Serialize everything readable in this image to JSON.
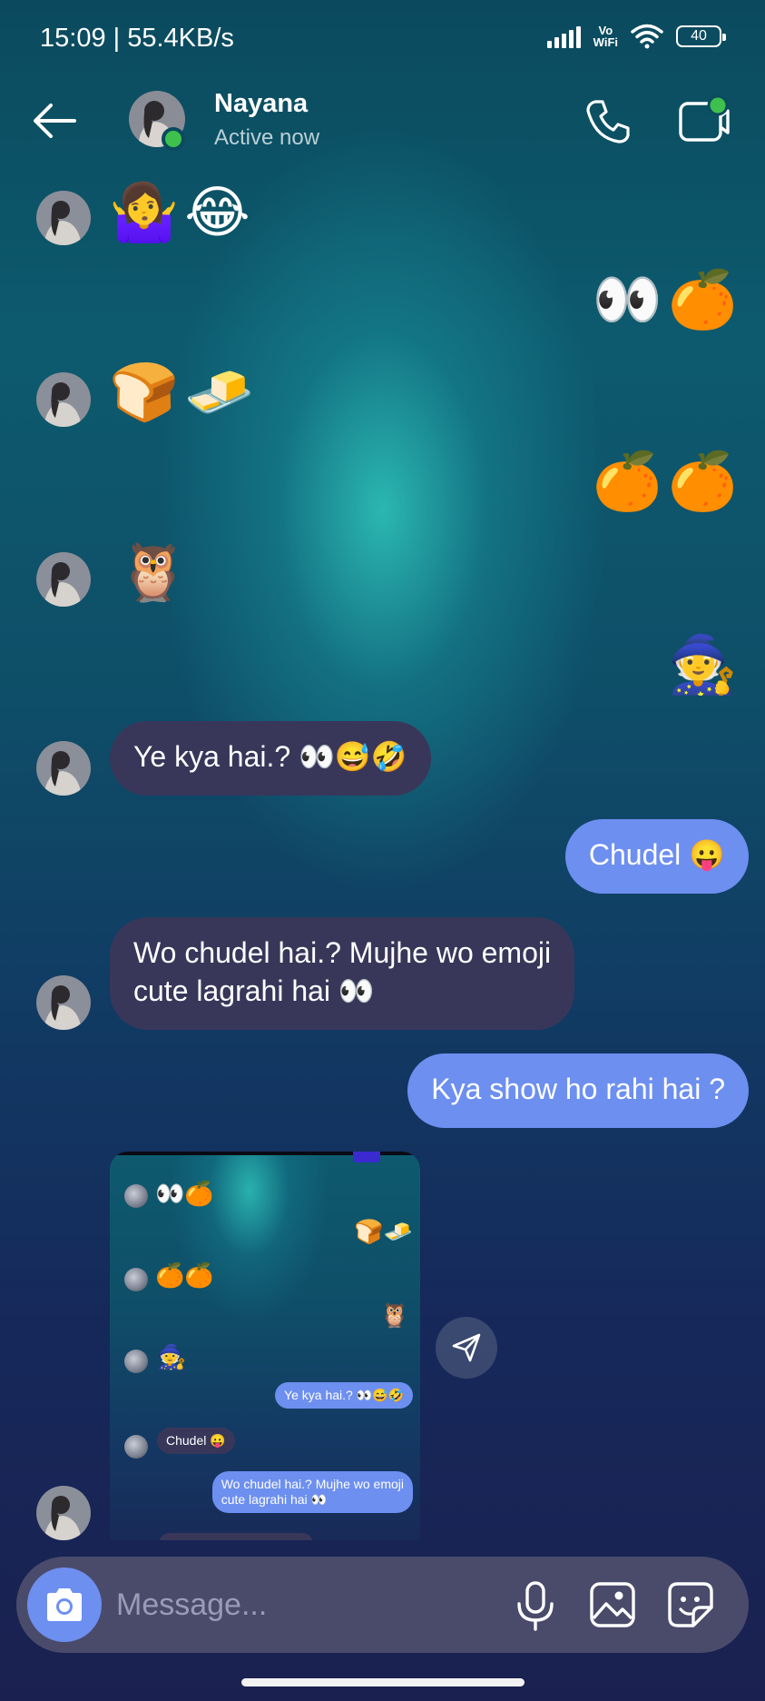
{
  "status_bar": {
    "time": "15:09 | 55.4KB/s",
    "network": "Vo WiFi",
    "network_top": "Vo",
    "network_bottom": "WiFi",
    "battery": "40"
  },
  "header": {
    "contact_name": "Nayana",
    "contact_status": "Active now",
    "online_color": "#3ec14c"
  },
  "messages": [
    {
      "side": "in",
      "kind": "emoji",
      "emojis": [
        "🤷‍♀️",
        "😂"
      ]
    },
    {
      "side": "out",
      "kind": "emoji",
      "emojis": [
        "👀",
        "🍊"
      ]
    },
    {
      "side": "in",
      "kind": "emoji",
      "emojis": [
        "🍞",
        "🧈"
      ]
    },
    {
      "side": "out",
      "kind": "emoji",
      "emojis": [
        "🍊",
        "🍊"
      ]
    },
    {
      "side": "in",
      "kind": "emoji",
      "emojis": [
        "🦉"
      ]
    },
    {
      "side": "out",
      "kind": "emoji",
      "emojis": [
        "🧙"
      ]
    },
    {
      "side": "in",
      "kind": "text",
      "text": "Ye kya hai.? 👀😅🤣"
    },
    {
      "side": "out",
      "kind": "text",
      "text": "Chudel 😛"
    },
    {
      "side": "in",
      "kind": "text",
      "text": "Wo chudel hai.? Mujhe wo emoji",
      "text_line2": "cute lagrahi hai 👀"
    },
    {
      "side": "out",
      "kind": "text",
      "text": "Kya show ho rahi hai ?"
    }
  ],
  "shared_screenshot": {
    "rows": [
      {
        "side": "in",
        "kind": "emoji",
        "value": "👀🍊"
      },
      {
        "side": "out",
        "kind": "emoji",
        "value": "🍞🧈"
      },
      {
        "side": "in",
        "kind": "emoji",
        "value": "🍊🍊"
      },
      {
        "side": "out",
        "kind": "emoji",
        "value": "🦉"
      },
      {
        "side": "in",
        "kind": "emoji",
        "value": "🧙"
      },
      {
        "side": "out",
        "kind": "text",
        "value": "Ye kya hai.? 👀😅🤣"
      },
      {
        "side": "in",
        "kind": "text",
        "value": "Chudel 😛"
      },
      {
        "side": "out",
        "kind": "text",
        "value": "Wo chudel hai.? Mujhe wo emoji",
        "value_line2": "cute lagrahi hai 👀"
      }
    ]
  },
  "composer": {
    "placeholder": "Message..."
  },
  "colors": {
    "incoming_bubble": "#38375a",
    "outgoing_bubble": "#6d8ff0",
    "composer_bg": "#4a4b6b"
  },
  "icons": [
    "back-arrow-icon",
    "phone-icon",
    "video-call-icon",
    "camera-icon",
    "microphone-icon",
    "image-icon",
    "sticker-icon",
    "send-icon"
  ]
}
